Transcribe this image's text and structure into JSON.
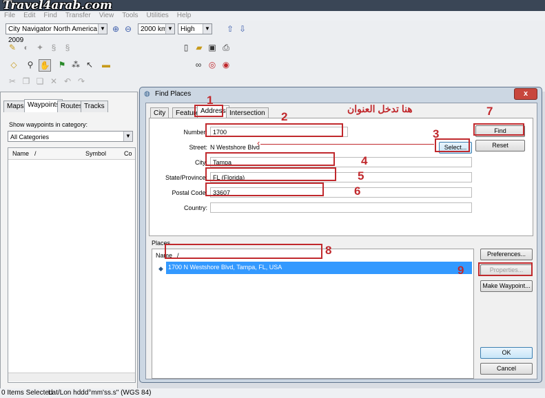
{
  "watermark": "Travel4arab.com",
  "menu": [
    "File",
    "Edit",
    "Find",
    "Transfer",
    "View",
    "Tools",
    "Utilities",
    "Help"
  ],
  "toolbar": {
    "map_product": "City Navigator North America 2009",
    "zoom_scale": "2000 km",
    "detail": "High"
  },
  "left_panel": {
    "tabs": [
      "Maps",
      "Waypoints",
      "Routes",
      "Tracks"
    ],
    "active_tab": "Waypoints",
    "category_label": "Show waypoints in category:",
    "category_value": "All Categories",
    "columns": [
      "Name",
      "/",
      "Symbol",
      "Co"
    ]
  },
  "status_bar": {
    "items": "0 Items Selected",
    "format": "Lat/Lon hddd°mm'ss.s\" (WGS 84)"
  },
  "dialog": {
    "title": "Find Places",
    "close": "x",
    "tabs": [
      "City",
      "Feature",
      "Address",
      "Intersection"
    ],
    "active_tab": "Address",
    "labels": {
      "number": "Number:",
      "street": "Street:",
      "city": "City:",
      "state": "State/Province:",
      "postal": "Postal Code:",
      "country": "Country:"
    },
    "values": {
      "number": "1700",
      "street": "N Westshore Blvd",
      "city": "Tampa",
      "state": "FL (Florida)",
      "postal": "33607",
      "country": ""
    },
    "buttons": {
      "select": "Select...",
      "find": "Find",
      "reset": "Reset",
      "preferences": "Preferences...",
      "properties": "Properties...",
      "make_waypoint": "Make Waypoint...",
      "ok": "OK",
      "cancel": "Cancel"
    },
    "places_label": "Places",
    "places_columns": [
      "Name",
      "/"
    ],
    "result": "1700 N Westshore Blvd, Tampa, FL, USA"
  },
  "annotations": {
    "arabic_note": "هنا تدخل العنوان",
    "numbers": [
      "1",
      "2",
      "3",
      "4",
      "5",
      "6",
      "7",
      "8",
      "9"
    ],
    "color": "#c0282c"
  }
}
